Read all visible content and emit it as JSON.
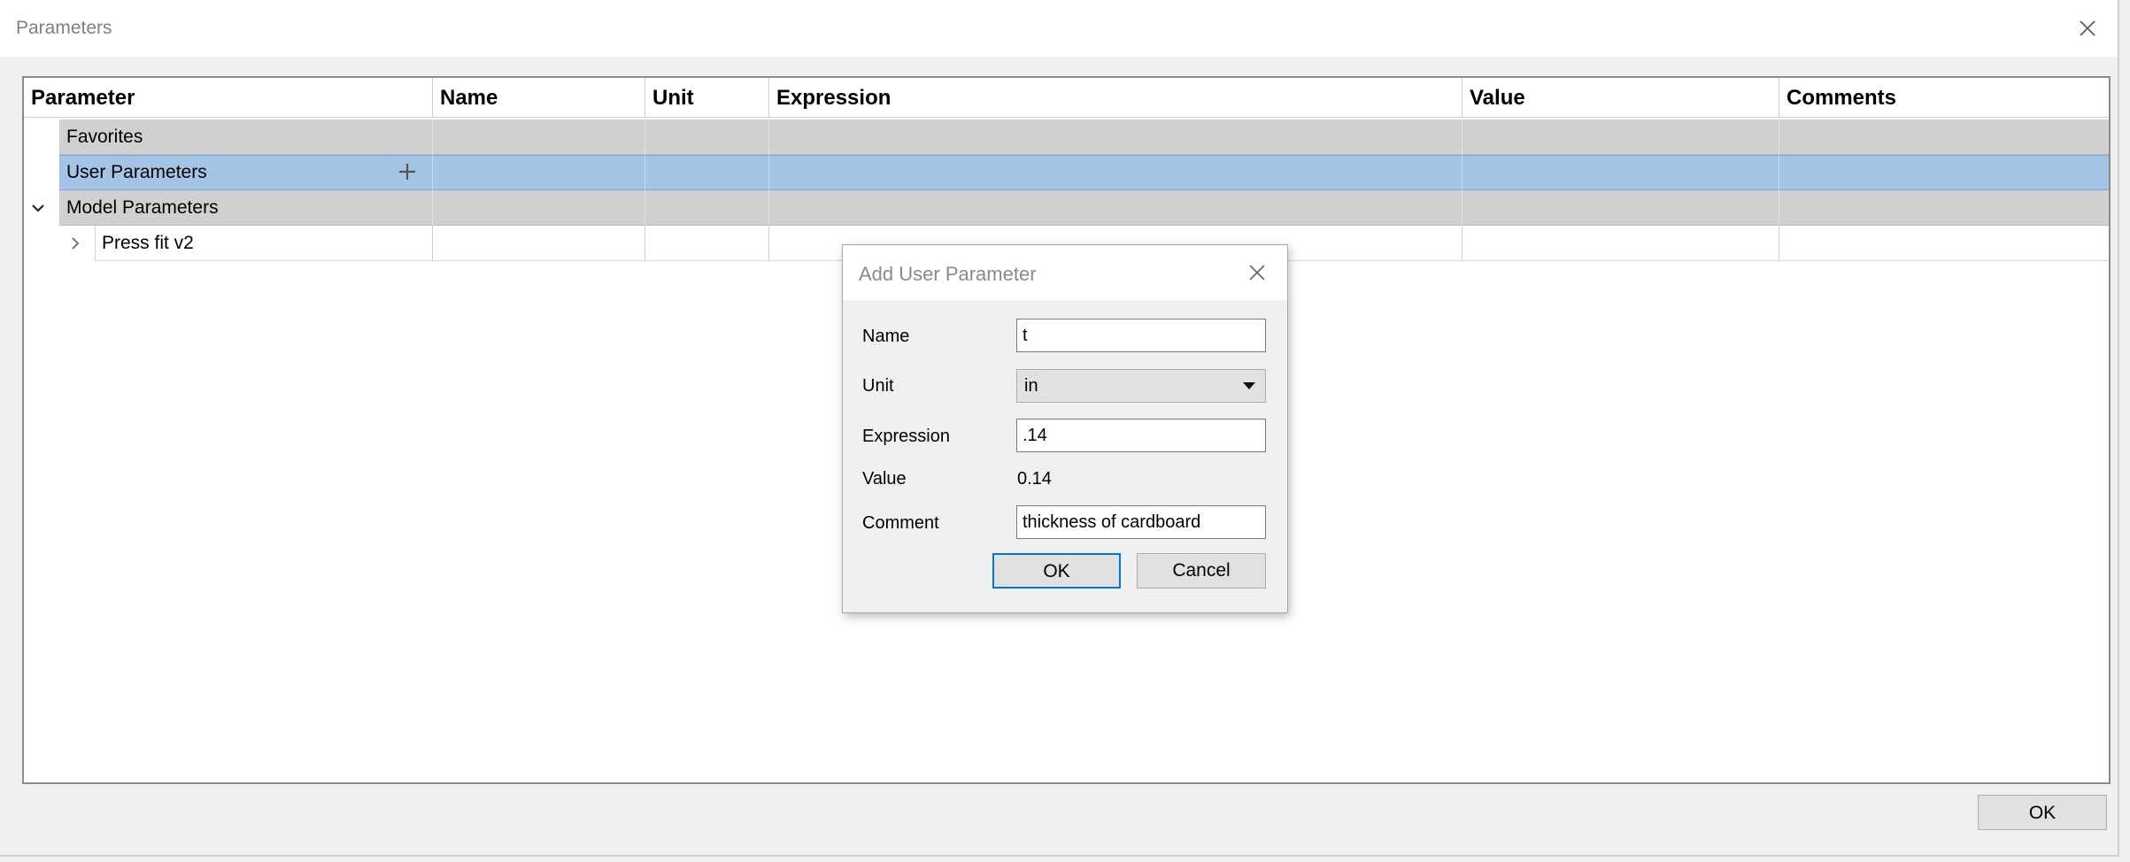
{
  "window": {
    "title": "Parameters",
    "ok_label": "OK"
  },
  "table": {
    "columns": [
      "Parameter",
      "Name",
      "Unit",
      "Expression",
      "Value",
      "Comments"
    ],
    "rows": [
      {
        "label": "Favorites"
      },
      {
        "label": "User Parameters"
      },
      {
        "label": "Model Parameters"
      },
      {
        "label": "Press fit v2"
      }
    ]
  },
  "dialog": {
    "title": "Add User Parameter",
    "labels": {
      "name": "Name",
      "unit": "Unit",
      "expression": "Expression",
      "value": "Value",
      "comment": "Comment"
    },
    "fields": {
      "name": "t",
      "unit": "in",
      "expression": ".14",
      "value": "0.14",
      "comment": "thickness of cardboard"
    },
    "ok_label": "OK",
    "cancel_label": "Cancel"
  },
  "colors": {
    "selected_row": "#a3c4e4",
    "group_row": "#d0d0d0",
    "focus_border": "#0078d7"
  },
  "icons": [
    "close-icon",
    "add-icon",
    "chevron-down-icon",
    "chevron-right-icon",
    "dropdown-arrow-icon"
  ]
}
